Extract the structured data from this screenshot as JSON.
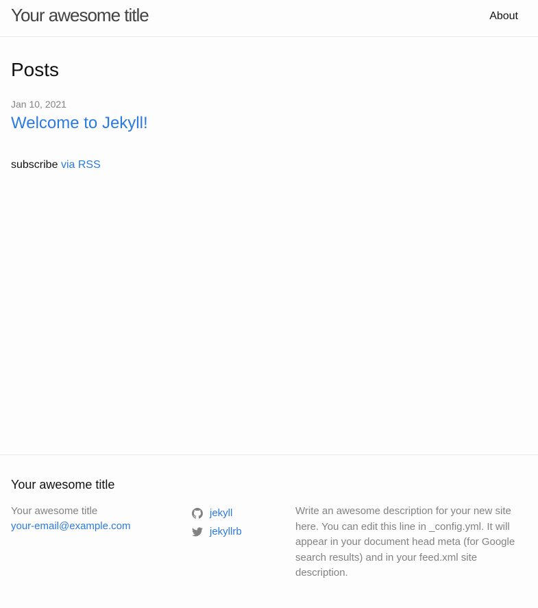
{
  "header": {
    "site_title": "Your awesome title",
    "nav": [
      {
        "label": "About"
      }
    ]
  },
  "main": {
    "heading": "Posts",
    "posts": [
      {
        "date": "Jan 10, 2021",
        "title": "Welcome to Jekyll!"
      }
    ],
    "rss": {
      "prefix": "subscribe",
      "link_label": "via RSS"
    }
  },
  "footer": {
    "heading": "Your awesome title",
    "site_name": "Your awesome title",
    "email": "your-email@example.com",
    "social": [
      {
        "icon": "github-icon",
        "label": "jekyll"
      },
      {
        "icon": "twitter-icon",
        "label": "jekyllrb"
      }
    ],
    "description": "Write an awesome description for your new site here. You can edit this line in _config.yml. It will appear in your document head meta (for Google search results) and in your feed.xml site description."
  },
  "colors": {
    "background": "#fdfdfd",
    "text": "#111111",
    "link": "#2a7ae2",
    "muted": "#828282",
    "border": "#e8e8e8"
  }
}
